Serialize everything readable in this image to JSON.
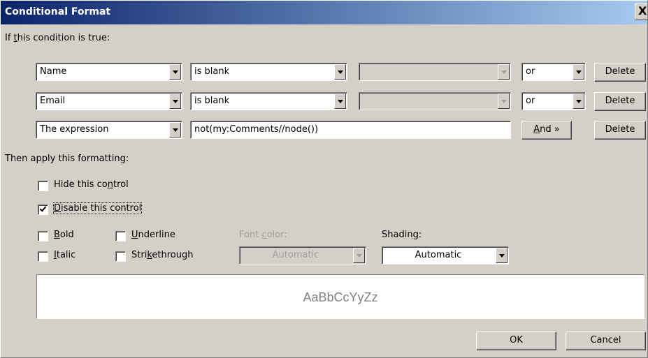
{
  "dialog": {
    "title": "Conditional Format",
    "close_glyph": "X"
  },
  "condition": {
    "label_pre": "If ",
    "label_accel": "t",
    "label_post": "his condition is true:",
    "rows": [
      {
        "field": "Name",
        "operator": "is blank",
        "value": "",
        "conjunction": "or",
        "delete_label": "Delete"
      },
      {
        "field": "Email",
        "operator": "is blank",
        "value": "",
        "conjunction": "or",
        "delete_label": "Delete"
      },
      {
        "field": "The expression",
        "expression": "not(my:Comments//node())",
        "and_accel": "A",
        "and_rest": "nd »",
        "delete_label": "Delete"
      }
    ]
  },
  "formatting": {
    "label": "Then apply this formatting:",
    "hide": {
      "pre": "Hide this co",
      "accel": "n",
      "post": "trol",
      "checked": false
    },
    "disable": {
      "accel": "D",
      "post": "isable this control",
      "checked": true
    },
    "bold": {
      "accel": "B",
      "post": "old",
      "checked": false
    },
    "italic": {
      "accel": "I",
      "post": "talic",
      "checked": false
    },
    "underline": {
      "accel": "U",
      "post": "nderline",
      "checked": false
    },
    "strikethrough": {
      "pre": "Stri",
      "accel": "k",
      "post": "ethrough",
      "checked": false
    },
    "font_color": {
      "pre": "Font ",
      "accel": "c",
      "post": "olor:",
      "value": "Automatic",
      "enabled": false
    },
    "shading": {
      "pre": "Shadin",
      "accel": "g",
      "post": ":",
      "value": "Automatic"
    },
    "preview_text": "AaBbCcYyZz"
  },
  "footer": {
    "ok_label": "OK",
    "cancel_label": "Cancel"
  }
}
